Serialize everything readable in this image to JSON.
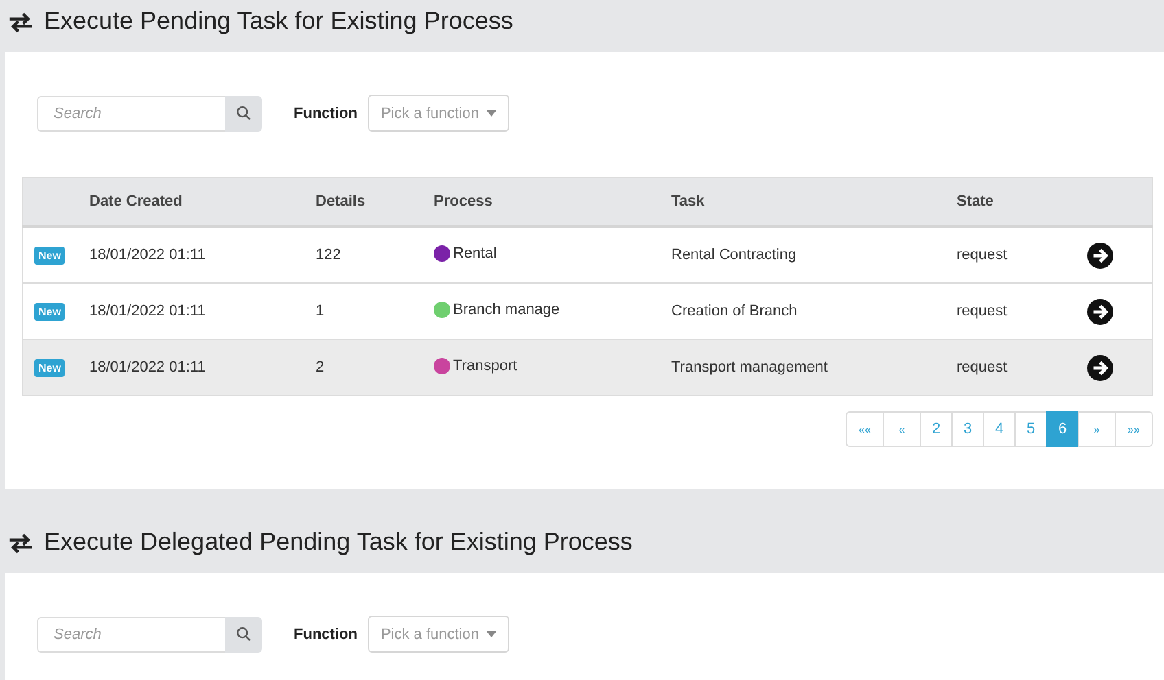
{
  "sections": [
    {
      "title": "Execute Pending Task for Existing Process",
      "search": {
        "placeholder": "Search"
      },
      "function_label": "Function",
      "function_select": {
        "placeholder": "Pick a function"
      },
      "table": {
        "columns": [
          "",
          "Date Created",
          "Details",
          "Process",
          "Task",
          "State",
          ""
        ],
        "rows": [
          {
            "badge": "New",
            "date": "18/01/2022 01:11",
            "details": "122",
            "process": "Rental",
            "color": "#7b22a8",
            "task": "Rental Contracting",
            "state": "request",
            "selected": false
          },
          {
            "badge": "New",
            "date": "18/01/2022 01:11",
            "details": "1",
            "process": "Branch manage",
            "color": "#6fcf6f",
            "task": "Creation of Branch",
            "state": "request",
            "selected": false
          },
          {
            "badge": "New",
            "date": "18/01/2022 01:11",
            "details": "2",
            "process": "Transport",
            "color": "#c9449e",
            "task": "Transport management",
            "state": "request",
            "selected": true
          }
        ]
      },
      "pagination": [
        {
          "label": "««",
          "selected": false
        },
        {
          "label": "«",
          "selected": false
        },
        {
          "label": "2",
          "selected": false
        },
        {
          "label": "3",
          "selected": false
        },
        {
          "label": "4",
          "selected": false
        },
        {
          "label": "5",
          "selected": false
        },
        {
          "label": "6",
          "selected": true
        },
        {
          "label": "»",
          "selected": false
        },
        {
          "label": "»»",
          "selected": false
        }
      ]
    },
    {
      "title": "Execute Delegated Pending Task for Existing Process",
      "search": {
        "placeholder": "Search"
      },
      "function_label": "Function",
      "function_select": {
        "placeholder": "Pick a function"
      }
    }
  ]
}
